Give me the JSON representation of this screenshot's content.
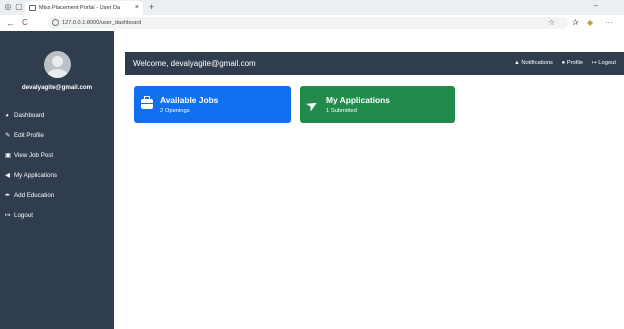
{
  "browser": {
    "tab_title": "Miss Placement Portal - User Da",
    "tab_close": "×",
    "new_tab": "+",
    "minimize": "–",
    "back": "←",
    "reload": "C",
    "url": "127.0.0.1:8000/user_dashboard",
    "star": "☆",
    "favorites": "✰",
    "more": "···"
  },
  "sidebar": {
    "email": "devalyagite@gmail.com",
    "items": [
      {
        "label": "Dashboard",
        "icon": "tachometer-icon",
        "glyph": "◕"
      },
      {
        "label": "Edit Profile",
        "icon": "user-edit-icon",
        "glyph": "✎"
      },
      {
        "label": "View Job Post",
        "icon": "briefcase-icon",
        "glyph": "▣"
      },
      {
        "label": "My Applications",
        "icon": "paper-plane-icon",
        "glyph": "◀"
      },
      {
        "label": "Add Education",
        "icon": "pen-icon",
        "glyph": "✒"
      },
      {
        "label": "Logout",
        "icon": "sign-out-icon",
        "glyph": "↦"
      }
    ]
  },
  "topbar": {
    "welcome": "Welcome, devalyagite@gmail.com",
    "notifications": "Notifications",
    "profile": "Profile",
    "logout": "Logout",
    "bell_glyph": "▲",
    "user_glyph": "●",
    "logout_glyph": "↦"
  },
  "cards": {
    "jobs": {
      "title": "Available Jobs",
      "subtitle": "2 Openings",
      "color": "#1170f0"
    },
    "applications": {
      "title": "My Applications",
      "subtitle": "1 Submitted",
      "color": "#208b4b",
      "glyph": "➤"
    }
  }
}
